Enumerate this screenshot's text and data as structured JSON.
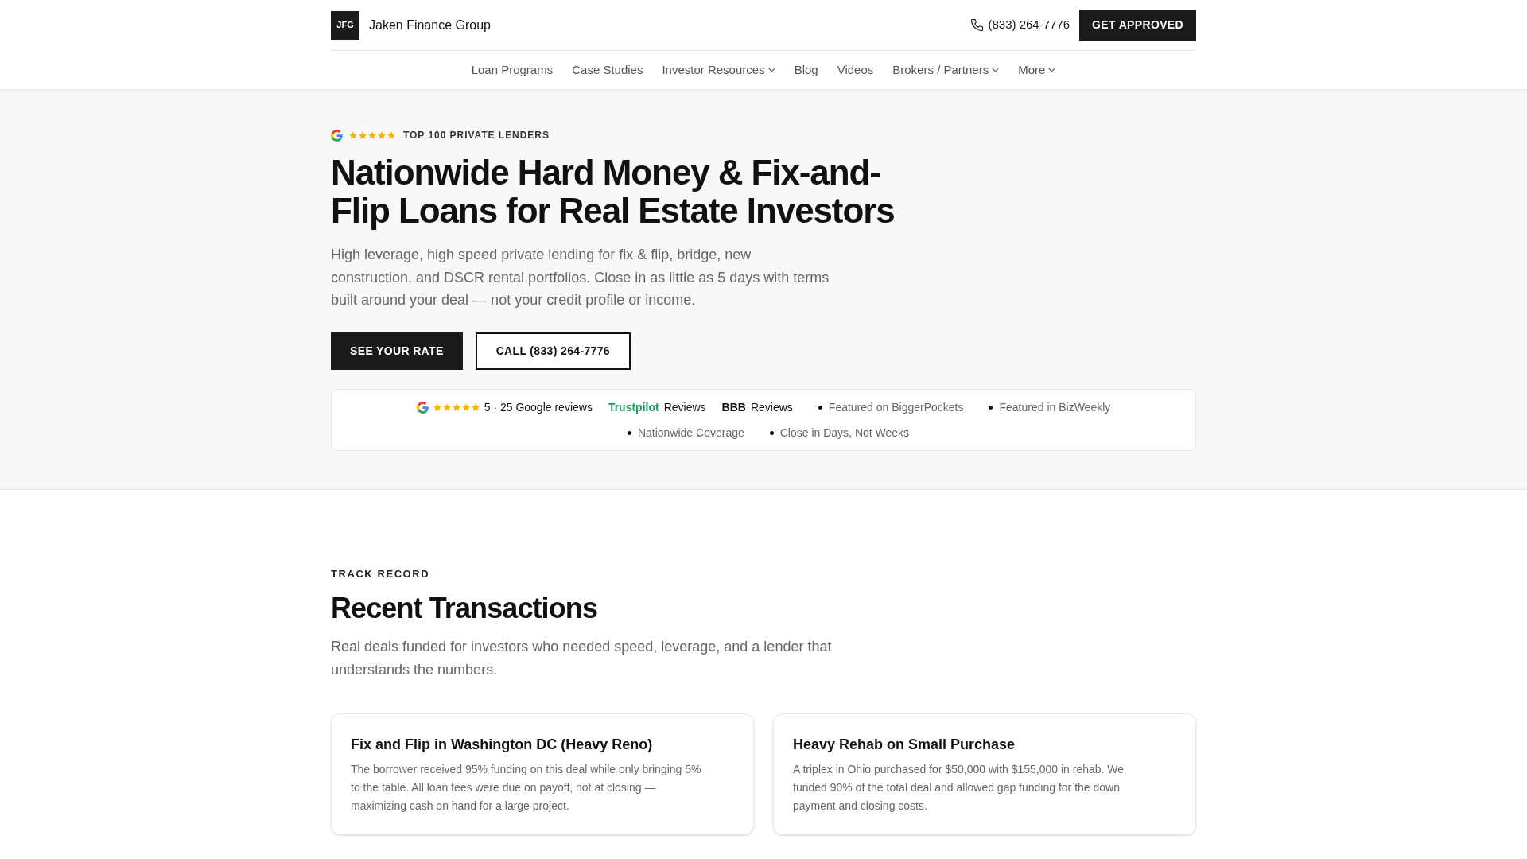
{
  "header": {
    "logo_mark": "JFG",
    "brand": "Jaken Finance Group",
    "phone": "(833) 264-7776",
    "cta": "GET APPROVED"
  },
  "nav": [
    {
      "label": "Loan Programs",
      "has_menu": false
    },
    {
      "label": "Case Studies",
      "has_menu": false
    },
    {
      "label": "Investor Resources",
      "has_menu": true
    },
    {
      "label": "Blog",
      "has_menu": false
    },
    {
      "label": "Videos",
      "has_menu": false
    },
    {
      "label": "Brokers / Partners",
      "has_menu": true
    },
    {
      "label": "More",
      "has_menu": true
    }
  ],
  "hero": {
    "badge": {
      "stars": 5,
      "label": "TOP 100 PRIVATE LENDERS"
    },
    "title": "Nationwide Hard Money & Fix-and-Flip Loans for Real Estate Investors",
    "text": "High leverage, high speed private lending for fix & flip, bridge, new construction, and DSCR rental portfolios. Close in as little as 5 days with terms built around your deal — not your credit profile or income.",
    "buttons": [
      {
        "label": "SEE YOUR RATE",
        "kind": "primary"
      },
      {
        "label": "CALL (833) 264-7776",
        "kind": "outline"
      }
    ],
    "proof": [
      {
        "kind": "google",
        "stars": 5,
        "text": "5 · 25 Google reviews"
      },
      {
        "kind": "brand",
        "brand": "Trustpilot",
        "color": "#1f9d63",
        "text": "Reviews"
      },
      {
        "kind": "brand",
        "brand": "BBB",
        "color": "#111111",
        "text": "Reviews"
      },
      {
        "kind": "feature",
        "text": "Featured on BiggerPockets"
      },
      {
        "kind": "feature",
        "text": "Featured in BizWeekly"
      },
      {
        "kind": "feature",
        "text": "Nationwide Coverage"
      },
      {
        "kind": "feature",
        "text": "Close in Days, Not Weeks"
      }
    ]
  },
  "track_record": {
    "eyebrow": "TRACK RECORD",
    "title": "Recent Transactions",
    "text": "Real deals funded for investors who needed speed, leverage, and a lender that understands the numbers.",
    "cards": [
      {
        "title": "Fix and Flip in Washington DC (Heavy Reno)",
        "text": "The borrower received 95% funding on this deal while only bringing 5% to the table. All loan fees were due on payoff, not at closing — maximizing cash on hand for a large project."
      },
      {
        "title": "Heavy Rehab on Small Purchase",
        "text": "A triplex in Ohio purchased for $50,000 with $155,000 in rehab. We funded 90% of the total deal and allowed gap funding for the down payment and closing costs."
      }
    ]
  }
}
